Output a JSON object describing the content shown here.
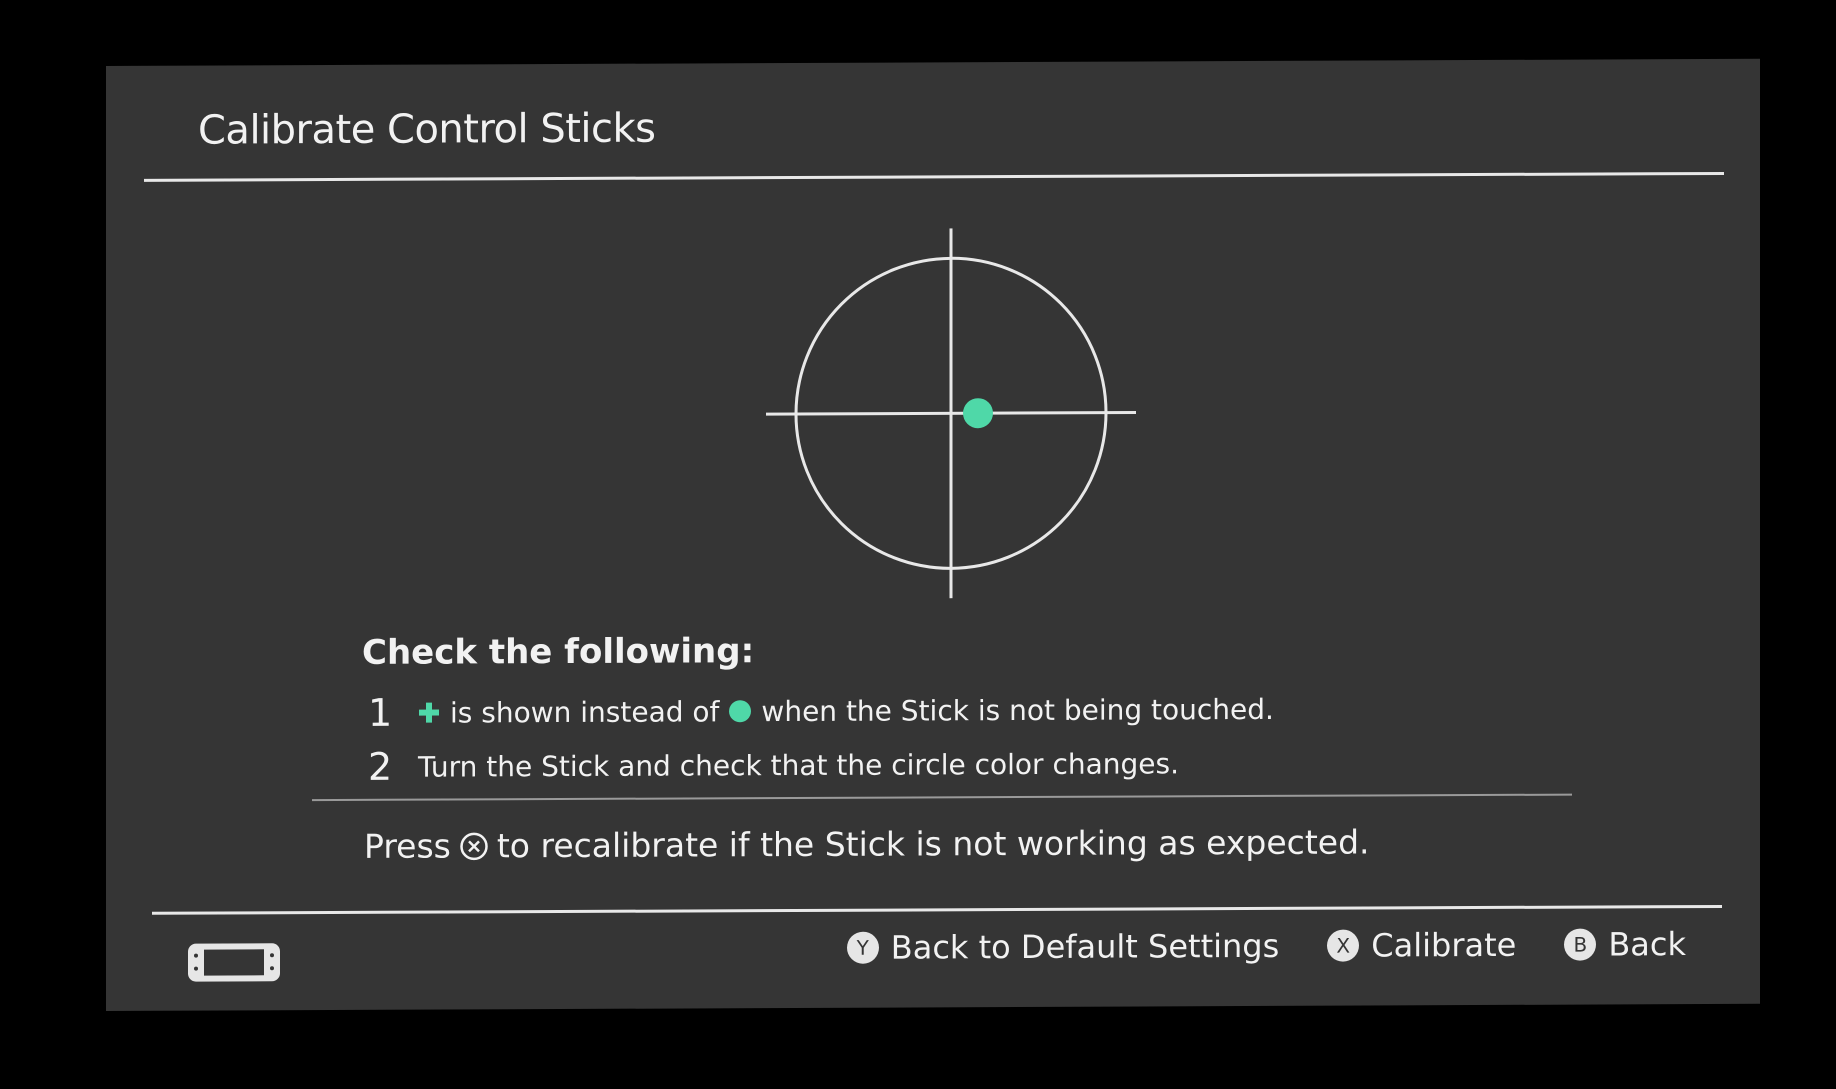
{
  "header": {
    "title": "Calibrate Control Sticks"
  },
  "instructions": {
    "heading": "Check the following:",
    "items": [
      {
        "number": "1",
        "text_before": "is shown instead of",
        "text_after": "when the Stick is not being touched."
      },
      {
        "number": "2",
        "text": "Turn the Stick and check that the circle color changes."
      }
    ],
    "press_before": "Press",
    "press_after": "to recalibrate if the Stick is not working as expected."
  },
  "footer": {
    "buttons": [
      {
        "glyph": "Y",
        "label": "Back to Default Settings"
      },
      {
        "glyph": "X",
        "label": "Calibrate"
      },
      {
        "glyph": "B",
        "label": "Back"
      }
    ]
  },
  "colors": {
    "background": "#353535",
    "accent": "#4fd8a8",
    "text": "#f2f2f2"
  },
  "icons": {
    "plus": "plus-icon",
    "dot": "stick-dot-icon",
    "x_button": "x-button-icon",
    "handheld": "handheld-mode-icon"
  }
}
